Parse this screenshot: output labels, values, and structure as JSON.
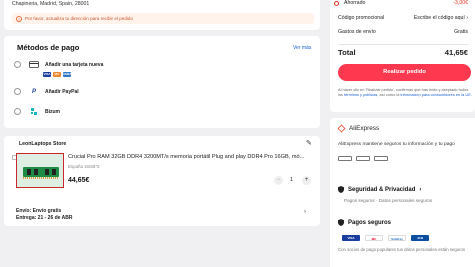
{
  "address": {
    "line": "Chapineria, Madrid, Spain, 28001",
    "warning": "Por favor, actualiza tu dirección para recibir el pedido"
  },
  "payment": {
    "title": "Métodos de pago",
    "see_more": "Ver más",
    "methods": [
      {
        "label": "Añadir una tarjeta nueva",
        "icon": "credit-card-icon"
      },
      {
        "label": "Añadir PayPal",
        "icon": "paypal-icon"
      },
      {
        "label": "Bizum",
        "icon": "bizum-icon"
      }
    ],
    "card_brands": [
      "VISA",
      "MC",
      "AMEX"
    ]
  },
  "store": {
    "name": "LeonLaptops Store",
    "product": {
      "title": "Crucial Pro RAM 32GB DDR4 3200MT/s memoria portátil Plug and play DDR4 Pro 16GB, mó...",
      "variant": "España 16GB*2",
      "price": "44,65€",
      "quantity": "1",
      "minus": "−",
      "plus": "+"
    },
    "shipping": "Envío: Envío gratis",
    "delivery": "Entrega: 21 - 26 de ABR"
  },
  "summary": {
    "saved_label": "Ahorrado",
    "saved_value": "-3,00€",
    "promo_label": "Código promocional",
    "promo_value": "Escribe el código aquí",
    "shipping_label": "Gastos de envío",
    "shipping_value": "Gratis",
    "total_label": "Total",
    "total_value": "41,65€",
    "checkout": "Realizar pedido",
    "legal_1": "Al hacer clic en 'Realizar pedido', confirmas que has leído y aceptado todos los ",
    "legal_link_1": "términos y políticas",
    "legal_2": ", así como la ",
    "legal_link_2": "información para consumidores en la UE",
    "legal_3": "."
  },
  "trust": {
    "brand": "AliExpress",
    "tagline": "AliExpress mantiene seguros tu información y tu pago",
    "security_title": "Seguridad & Privacidad",
    "security_sub": "Pagos seguros · Datos personales seguros",
    "payments_title": "Pagos seguros",
    "payment_logos": [
      "VISA",
      "MC",
      "SafeKey",
      "JCB"
    ],
    "payments_desc": "Con socios de pago populares tus datos personales están seguros"
  },
  "colors": {
    "accent": "#fd384f",
    "link": "#1a5fd1",
    "warning_bg": "#fff3ec",
    "warning_text": "#c9582d"
  }
}
